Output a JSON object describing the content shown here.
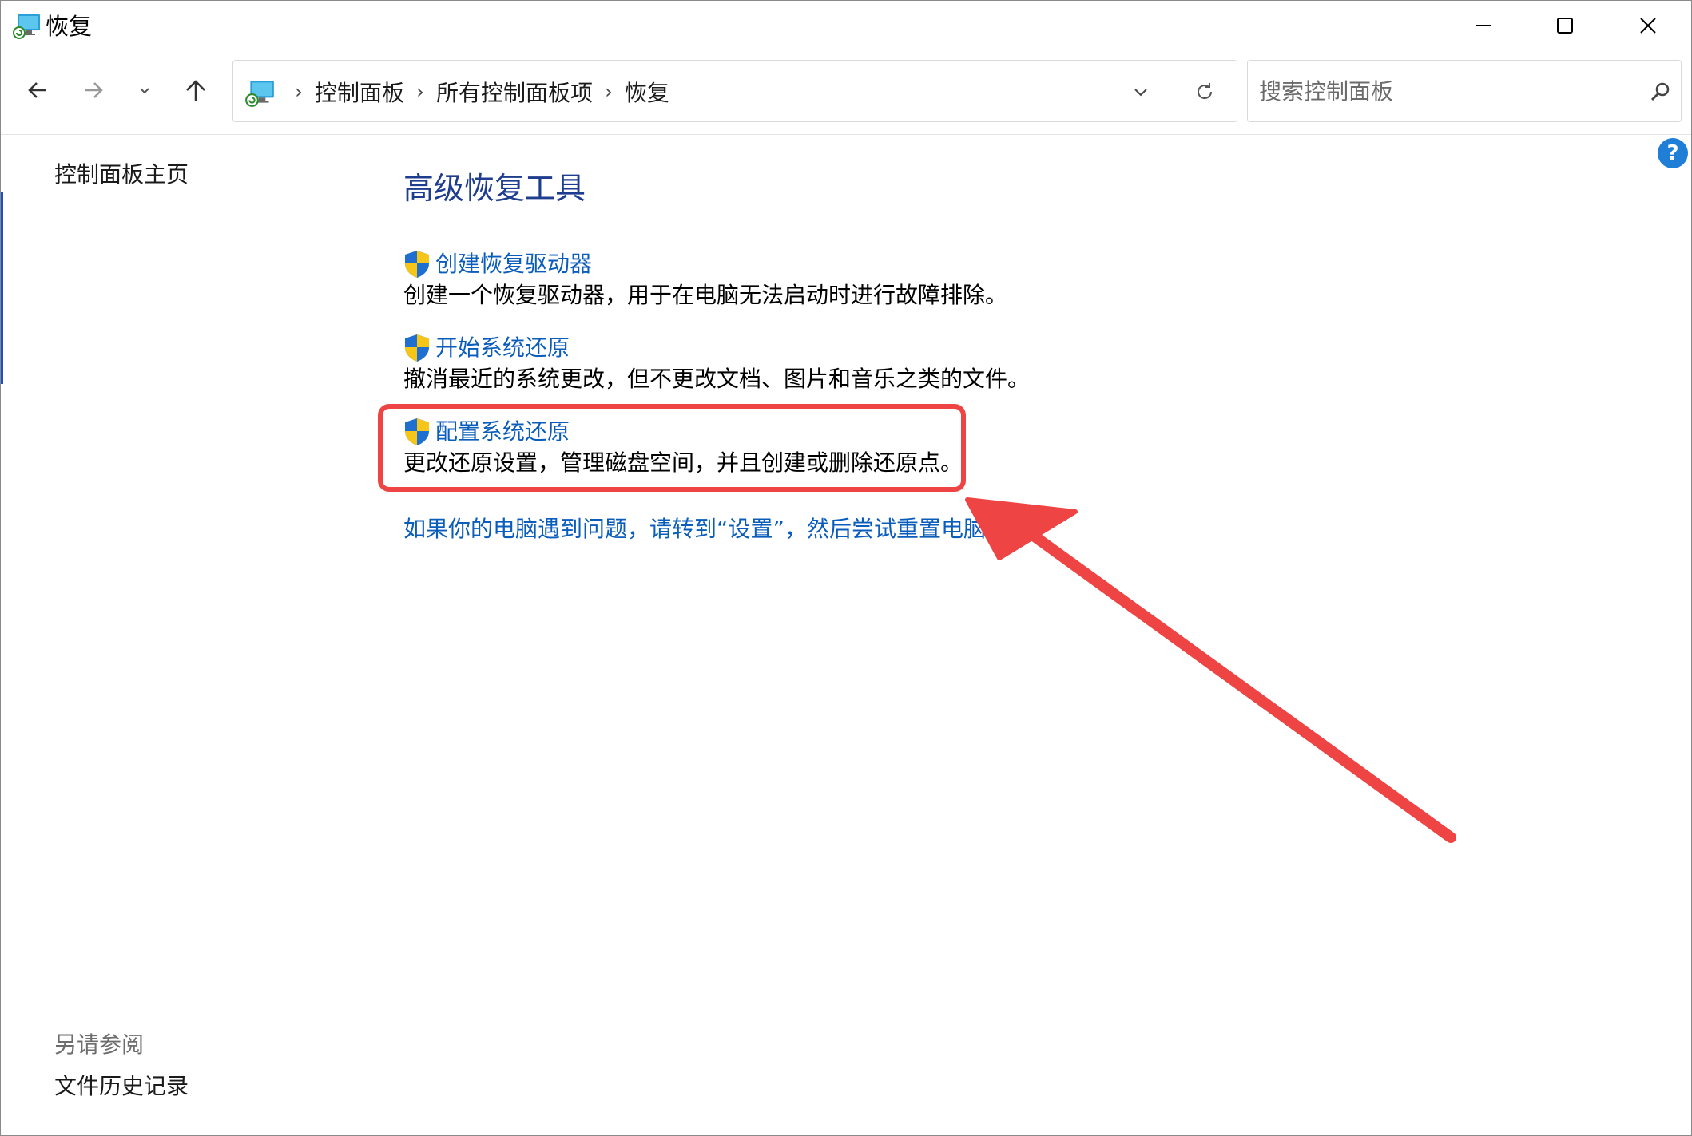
{
  "window": {
    "title": "恢复"
  },
  "navigation": {
    "breadcrumbs": [
      "控制面板",
      "所有控制面板项",
      "恢复"
    ],
    "separator": "›",
    "search_placeholder": "搜索控制面板"
  },
  "left_pane": {
    "home_link": "控制面板主页",
    "see_also_title": "另请参阅",
    "see_also_link": "文件历史记录"
  },
  "help": {
    "glyph": "?"
  },
  "main": {
    "heading": "高级恢复工具",
    "tasks": [
      {
        "label": "创建恢复驱动器",
        "description": "创建一个恢复驱动器，用于在电脑无法启动时进行故障排除。"
      },
      {
        "label": "开始系统还原",
        "description": "撤消最近的系统更改，但不更改文档、图片和音乐之类的文件。"
      },
      {
        "label": "配置系统还原",
        "description": "更改还原设置，管理磁盘空间，并且创建或删除还原点。"
      }
    ],
    "reset_link": "如果你的电脑遇到问题，请转到“设置”，然后尝试重置电脑"
  },
  "colors": {
    "link": "#0b5dbb",
    "heading": "#1e3d8f",
    "annotation": "#ef4444",
    "help": "#1f7fd6"
  },
  "icons": [
    "control-panel-recovery-icon",
    "shield-icon",
    "search-icon",
    "refresh-icon",
    "help-icon"
  ]
}
